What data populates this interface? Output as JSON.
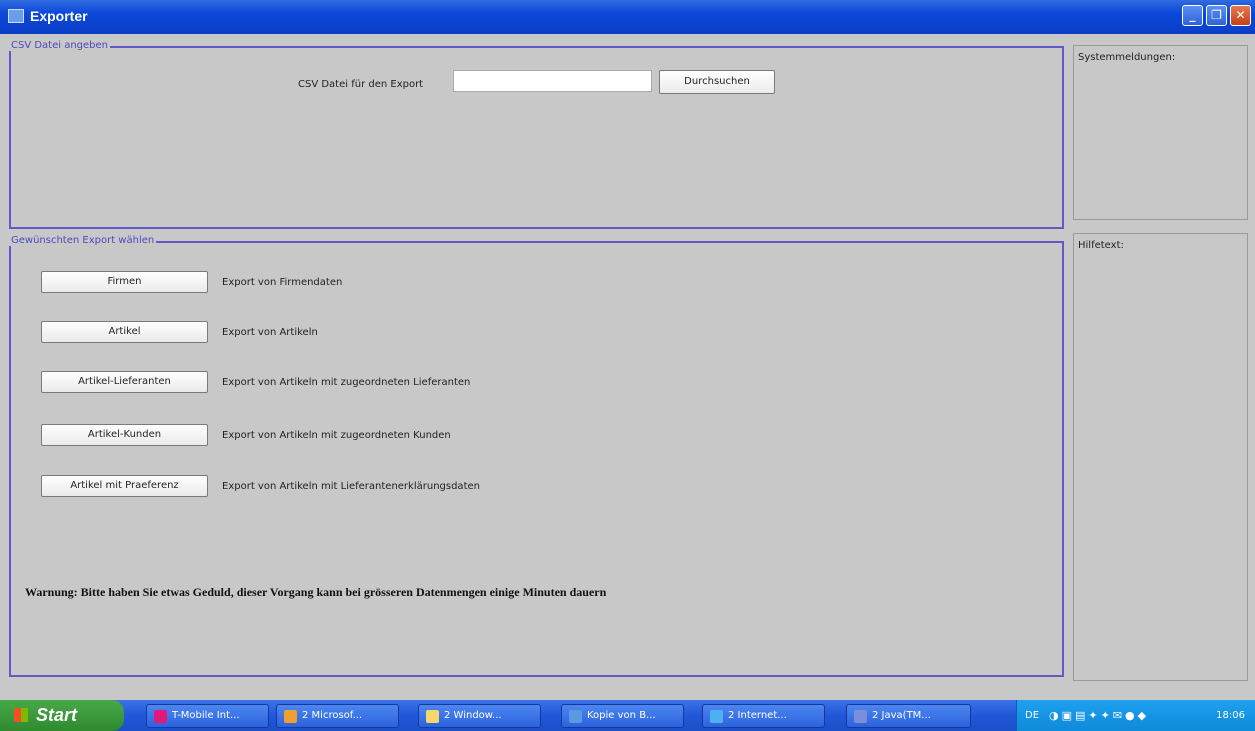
{
  "window": {
    "title": "Exporter",
    "minimize_glyph": "_",
    "maximize_glyph": "❐",
    "close_glyph": "✕"
  },
  "csv_group": {
    "title": "CSV Datei angeben",
    "label": "CSV Datei für den Export",
    "input_value": "",
    "browse_label": "Durchsuchen"
  },
  "export_group": {
    "title": "Gewünschten Export wählen",
    "items": [
      {
        "button": "Firmen",
        "description": "Export von Firmendaten"
      },
      {
        "button": "Artikel",
        "description": "Export von Artikeln"
      },
      {
        "button": "Artikel-Lieferanten",
        "description": "Export von Artikeln mit zugeordneten Lieferanten"
      },
      {
        "button": "Artikel-Kunden",
        "description": "Export von Artikeln mit zugeordneten Kunden"
      },
      {
        "button": "Artikel mit Praeferenz",
        "description": "Export von Artikeln mit Lieferantenerklärungsdaten"
      }
    ],
    "warning": "Warnung: Bitte haben Sie etwas Geduld, dieser Vorgang kann bei grösseren Datenmengen einige Minuten dauern"
  },
  "side_panels": {
    "system_messages_label": "Systemmeldungen:",
    "help_text_label": "Hilfetext:"
  },
  "taskbar": {
    "start_label": "Start",
    "tasks": [
      {
        "label": "T-Mobile Int...",
        "icon": "tmobile-icon",
        "color": "#e0197a"
      },
      {
        "label": "2 Microsof...",
        "icon": "outlook-icon",
        "color": "#f0a030"
      },
      {
        "label": "2 Window...",
        "icon": "folder-icon",
        "color": "#f5d76e"
      },
      {
        "label": "Kopie von B...",
        "icon": "image-icon",
        "color": "#5a9be0"
      },
      {
        "label": "2 Internet...",
        "icon": "ie-icon",
        "color": "#4fb0f0"
      },
      {
        "label": "2 Java(TM...",
        "icon": "java-icon",
        "color": "#7a8fd8"
      }
    ],
    "language": "DE",
    "tray_icons": "◑▣▤✦✦✉●◆",
    "clock": "18:06"
  }
}
